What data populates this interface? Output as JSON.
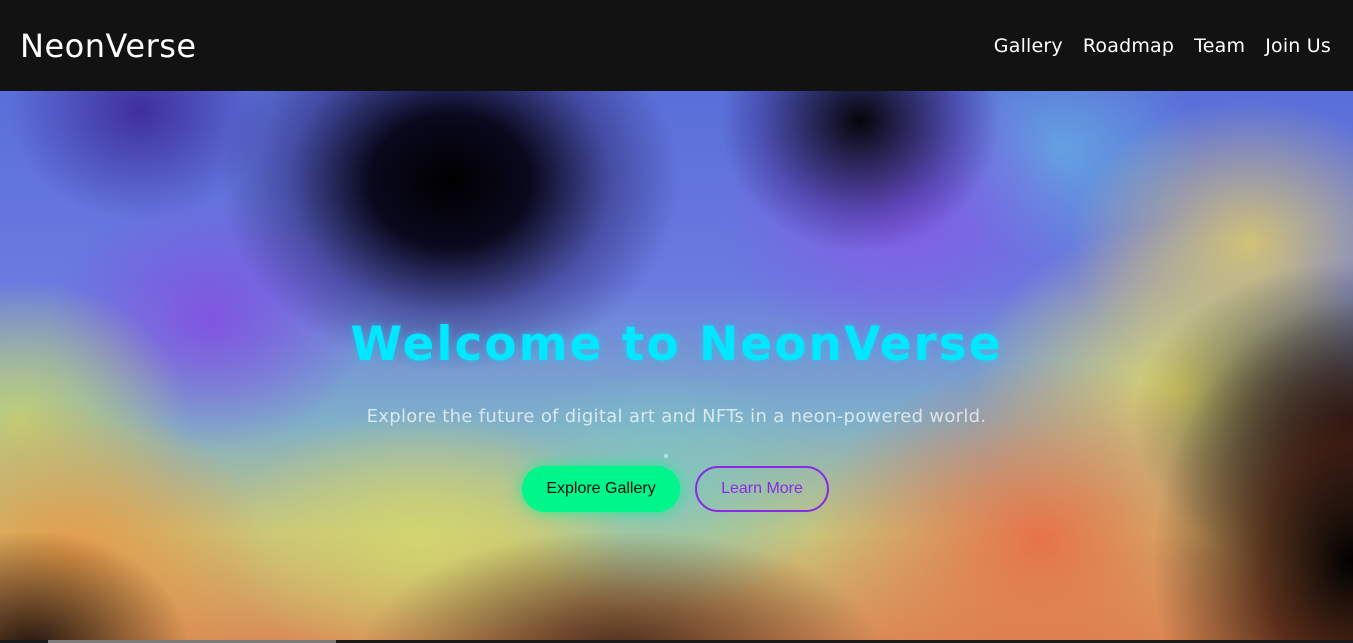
{
  "navbar": {
    "brand": "NeonVerse",
    "links": [
      "Gallery",
      "Roadmap",
      "Team",
      "Join Us"
    ]
  },
  "hero": {
    "title": "Welcome to NeonVerse",
    "subtitle": "Explore the future of digital art and NFTs in a neon-powered world.",
    "primary_button": "Explore Gallery",
    "secondary_button": "Learn More"
  },
  "colors": {
    "navbar_bg": "#121212",
    "title": "#00e7ff",
    "primary_button": "#00f58a",
    "secondary_button": "#8a2be2"
  }
}
